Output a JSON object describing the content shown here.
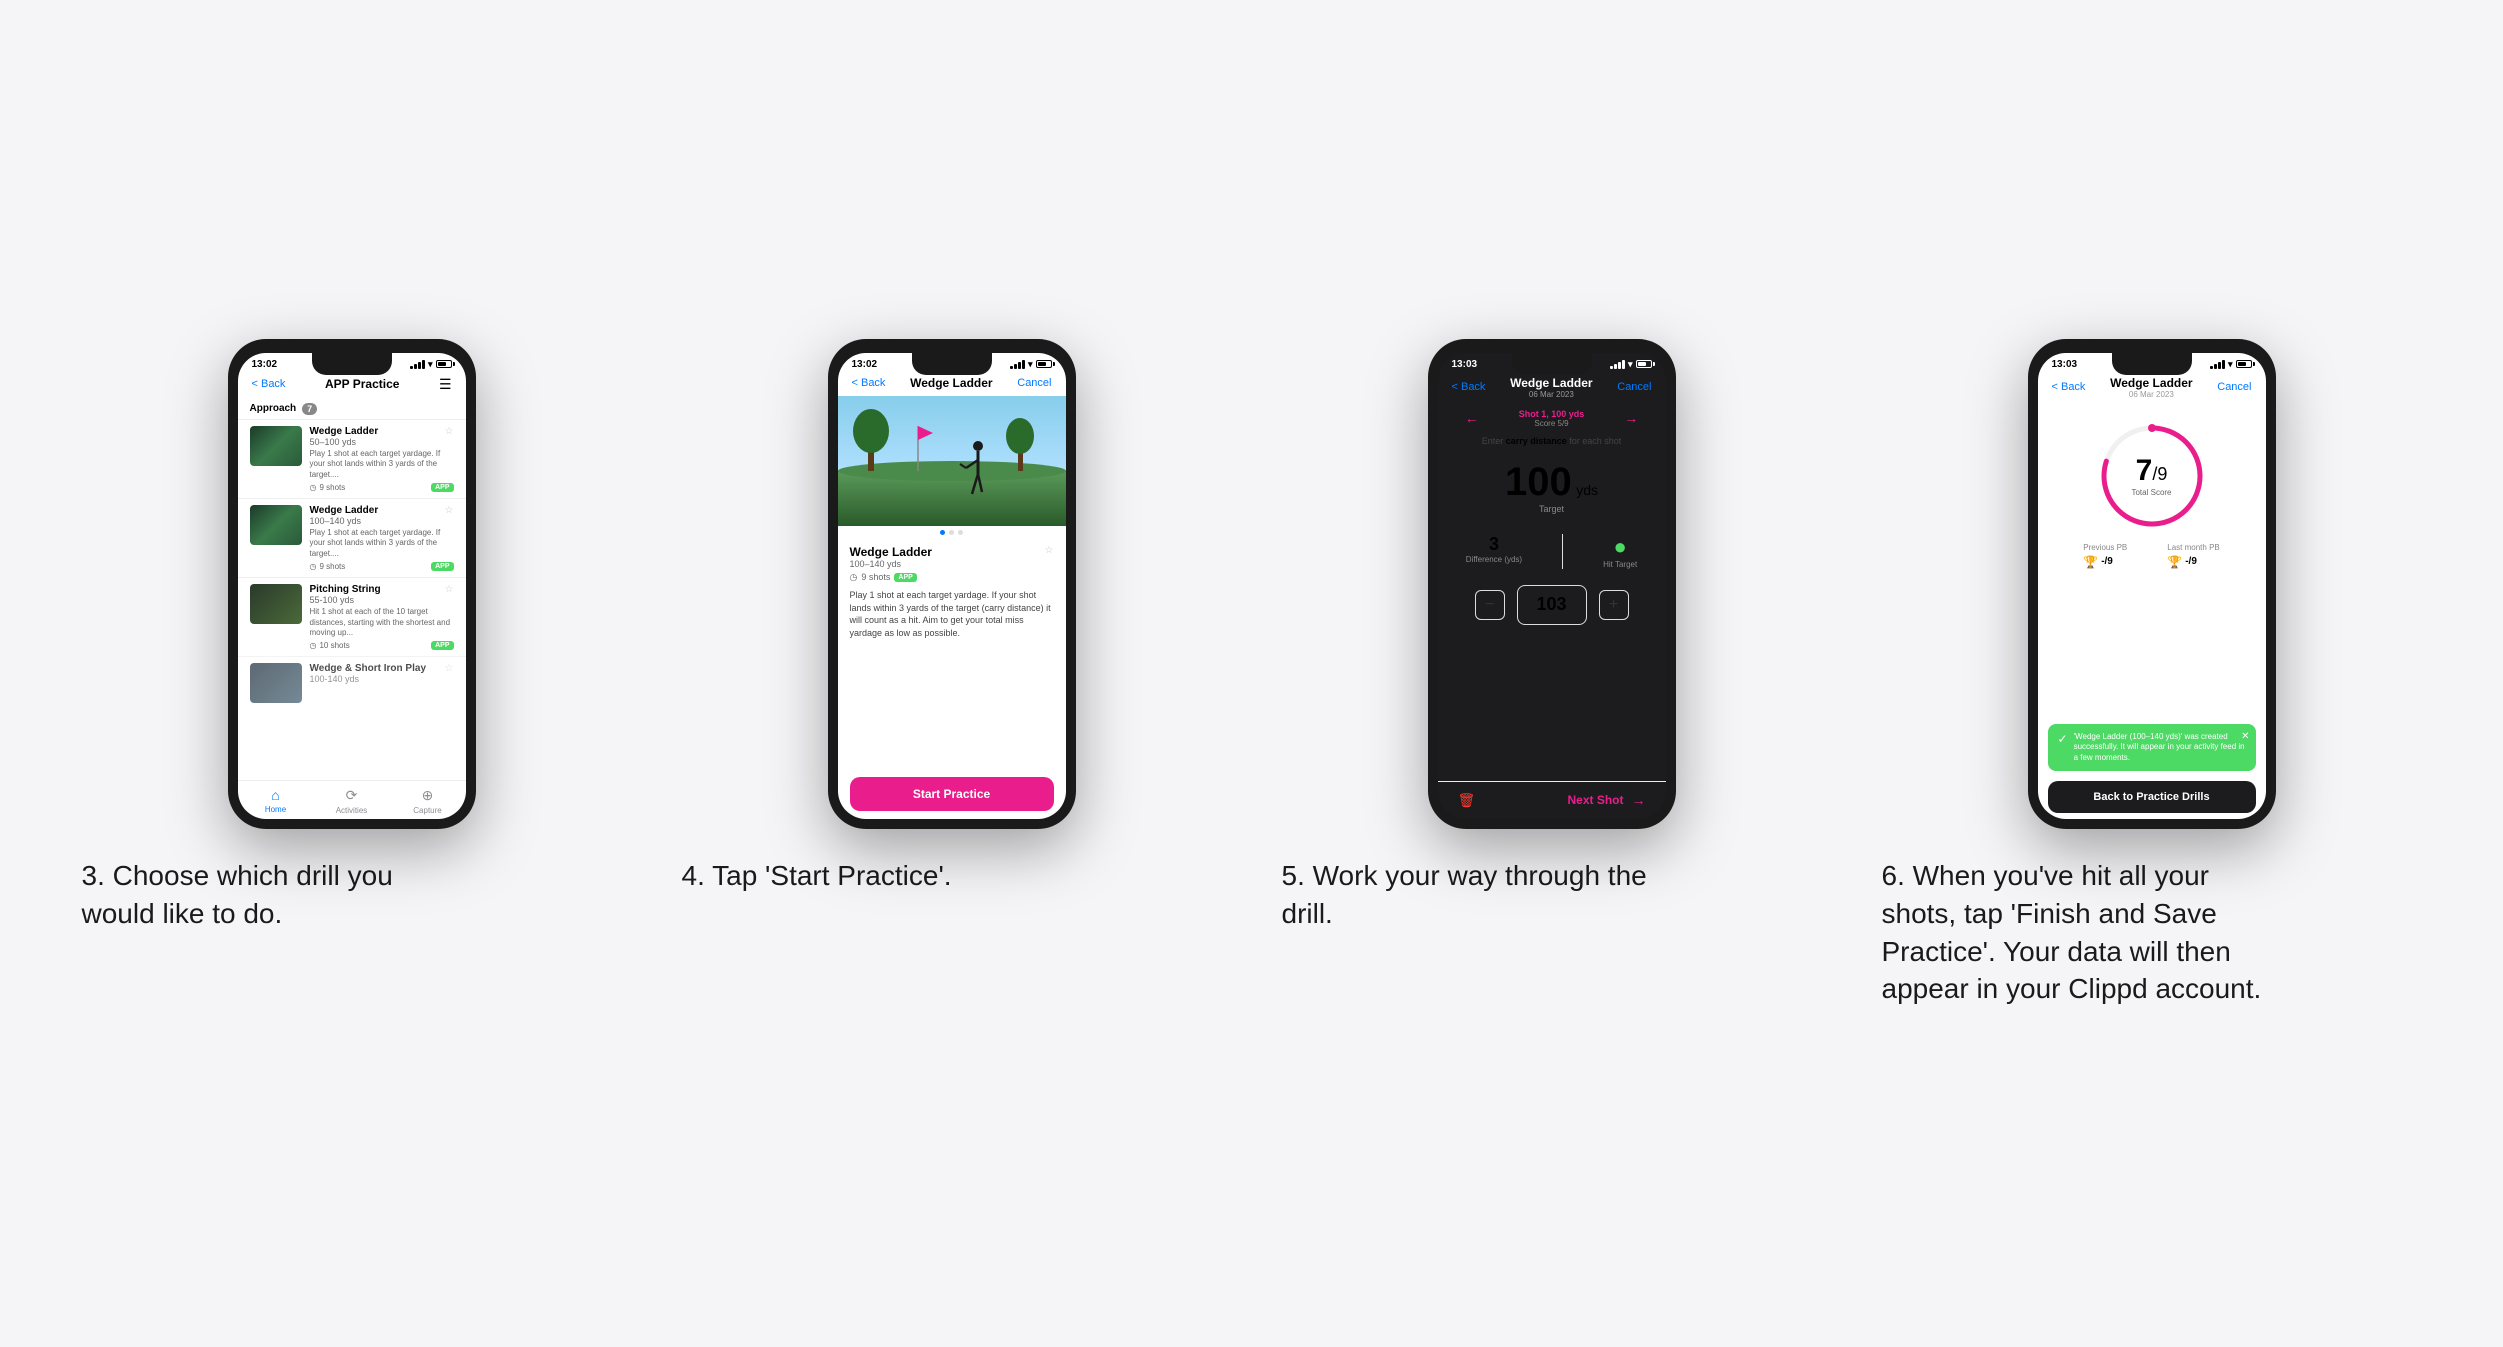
{
  "page": {
    "background": "#f5f5f7"
  },
  "steps": [
    {
      "number": "3",
      "caption": "3. Choose which drill you would like to do.",
      "phone": {
        "time": "13:02",
        "nav": {
          "back": "< Back",
          "title": "APP Practice",
          "icon": "☰"
        },
        "section": "Approach",
        "section_count": "7",
        "drills": [
          {
            "name": "Wedge Ladder",
            "yards": "50–100 yds",
            "desc": "Play 1 shot at each target yardage. If your shot lands within 3 yards of the target....",
            "shots": "9 shots",
            "badge": "APP"
          },
          {
            "name": "Wedge Ladder",
            "yards": "100–140 yds",
            "desc": "Play 1 shot at each target yardage. If your shot lands within 3 yards of the target....",
            "shots": "9 shots",
            "badge": "APP"
          },
          {
            "name": "Pitching String",
            "yards": "55-100 yds",
            "desc": "Hit 1 shot at each of the 10 target distances, starting with the shortest and moving up...",
            "shots": "10 shots",
            "badge": "APP"
          },
          {
            "name": "Wedge & Short Iron Play",
            "yards": "100-140 yds",
            "shots": "",
            "badge": ""
          }
        ],
        "bottom_nav": [
          {
            "icon": "⌂",
            "label": "Home",
            "active": true
          },
          {
            "icon": "♻",
            "label": "Activities",
            "active": false
          },
          {
            "icon": "⊕",
            "label": "Capture",
            "active": false
          }
        ]
      }
    },
    {
      "number": "4",
      "caption": "4. Tap 'Start Practice'.",
      "phone": {
        "time": "13:02",
        "nav": {
          "back": "< Back",
          "title": "Wedge Ladder",
          "action": "Cancel"
        },
        "drill": {
          "name": "Wedge Ladder",
          "yards": "100–140 yds",
          "shots": "9 shots",
          "badge": "APP",
          "description": "Play 1 shot at each target yardage. If your shot lands within 3 yards of the target (carry distance) it will count as a hit. Aim to get your total miss yardage as low as possible."
        },
        "start_button": "Start Practice"
      }
    },
    {
      "number": "5",
      "caption": "5. Work your way through the drill.",
      "phone": {
        "time": "13:03",
        "nav": {
          "back": "< Back",
          "title": "Wedge Ladder",
          "subtitle": "06 Mar 2023",
          "action": "Cancel"
        },
        "shot": {
          "label": "Shot 1, 100 yds",
          "score": "Score 5/9"
        },
        "carry_label": "Enter carry distance for each shot",
        "target": {
          "value": "100",
          "unit": "yds",
          "label": "Target"
        },
        "stats": {
          "difference": "3",
          "difference_label": "Difference (yds)",
          "hit_target": "●",
          "hit_target_label": "Hit Target"
        },
        "input_value": "103",
        "next_shot": "Next Shot"
      }
    },
    {
      "number": "6",
      "caption": "6. When you've hit all your shots, tap 'Finish and Save Practice'. Your data will then appear in your Clippd account.",
      "phone": {
        "time": "13:03",
        "nav": {
          "back": "< Back",
          "title": "Wedge Ladder",
          "subtitle": "06 Mar 2023",
          "action": "Cancel"
        },
        "score": {
          "value": "7",
          "total": "/9",
          "label": "Total Score"
        },
        "pb": {
          "previous_label": "Previous PB",
          "previous_val": "-/9",
          "last_month_label": "Last month PB",
          "last_month_val": "-/9"
        },
        "success_message": "'Wedge Ladder (100–140 yds)' was created successfully. It will appear in your activity feed in a few moments.",
        "back_button": "Back to Practice Drills"
      }
    }
  ]
}
